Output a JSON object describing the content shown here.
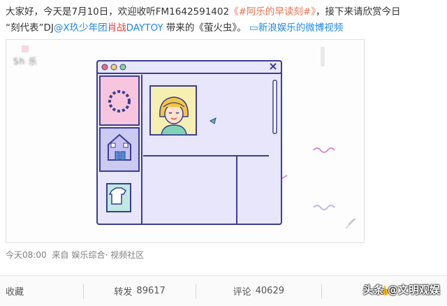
{
  "post": {
    "line1_prefix": "大家好，今天是7月10日，欢迎收听FM1642591402",
    "topic": "《#阿乐的早读刻#》",
    "line1_suffix": "，接下来请欣赏今日",
    "line2_prefix": "“刻代表”DJ",
    "mention": "@X玖少年团",
    "mention_red": "肖战",
    "mention_tail": "DAYTOY",
    "line2_mid": " 带来的《萤火虫》。 ",
    "video_link_icon": "video-icon",
    "video_link": "新浪娱乐的微博视频"
  },
  "video": {
    "blurred_label": "Sh    乐"
  },
  "meta": {
    "time": "今天08:00",
    "from_label": "来自",
    "source": "娱乐综合",
    "dot": "·",
    "community": "视频社区"
  },
  "actions": {
    "favorite": "收藏",
    "repost": "转发",
    "repost_count": "89617",
    "comment": "评论",
    "comment_count": "40629",
    "like_icon": "thumbs-up-icon"
  },
  "watermark": "头条 @文明观娱",
  "colors": {
    "topic": "#eb7350",
    "link": "#1e88e5",
    "highlight": "#e53935",
    "illustration_bg": "#e8e6fb",
    "illustration_stroke": "#3c3f8f"
  }
}
